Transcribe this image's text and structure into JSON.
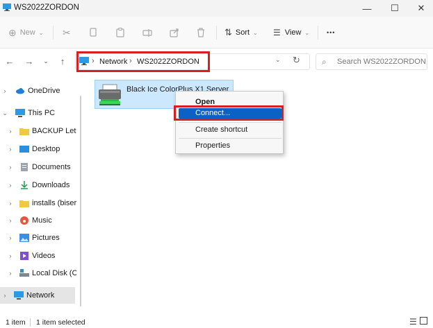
{
  "window": {
    "title": "WS2022ZORDON",
    "minimize_glyph": "—",
    "maximize_glyph": "☐",
    "close_glyph": "✕"
  },
  "toolbar": {
    "new_label": "New",
    "sort_label": "Sort",
    "view_label": "View",
    "more_glyph": "•••"
  },
  "address": {
    "crumbs": [
      "Network",
      "WS2022ZORDON"
    ],
    "separator": "›"
  },
  "search": {
    "placeholder": "Search WS2022ZORDON"
  },
  "sidebar": {
    "items": [
      {
        "label": "OneDrive",
        "icon": "cloud-icon",
        "expanded": false
      },
      {
        "label": "This PC",
        "icon": "pc-icon",
        "expanded": true
      },
      {
        "label": "BACKUP Letolt",
        "icon": "folder-icon",
        "expanded": false
      },
      {
        "label": "Desktop",
        "icon": "desktop-icon",
        "expanded": false
      },
      {
        "label": "Documents",
        "icon": "documents-icon",
        "expanded": false
      },
      {
        "label": "Downloads",
        "icon": "downloads-icon",
        "expanded": false
      },
      {
        "label": "installs (biserve",
        "icon": "folder-icon",
        "expanded": false
      },
      {
        "label": "Music",
        "icon": "music-icon",
        "expanded": false
      },
      {
        "label": "Pictures",
        "icon": "pictures-icon",
        "expanded": false
      },
      {
        "label": "Videos",
        "icon": "videos-icon",
        "expanded": false
      },
      {
        "label": "Local Disk (C:)",
        "icon": "disk-icon",
        "expanded": false
      },
      {
        "label": "Network",
        "icon": "network-icon",
        "expanded": false,
        "selected": true
      }
    ]
  },
  "content": {
    "items": [
      {
        "label": "Black Ice ColorPlus X1 Server",
        "icon": "printer-icon",
        "selected": true
      }
    ]
  },
  "context_menu": {
    "items": [
      "Open",
      "Connect...",
      "Create shortcut",
      "Properties"
    ],
    "highlighted": "Connect..."
  },
  "status": {
    "item_count": "1 item",
    "selection": "1 item selected"
  },
  "colors": {
    "accent": "#0b62c4",
    "selection_bg": "#cce8ff",
    "annotation_red": "#d42020"
  }
}
